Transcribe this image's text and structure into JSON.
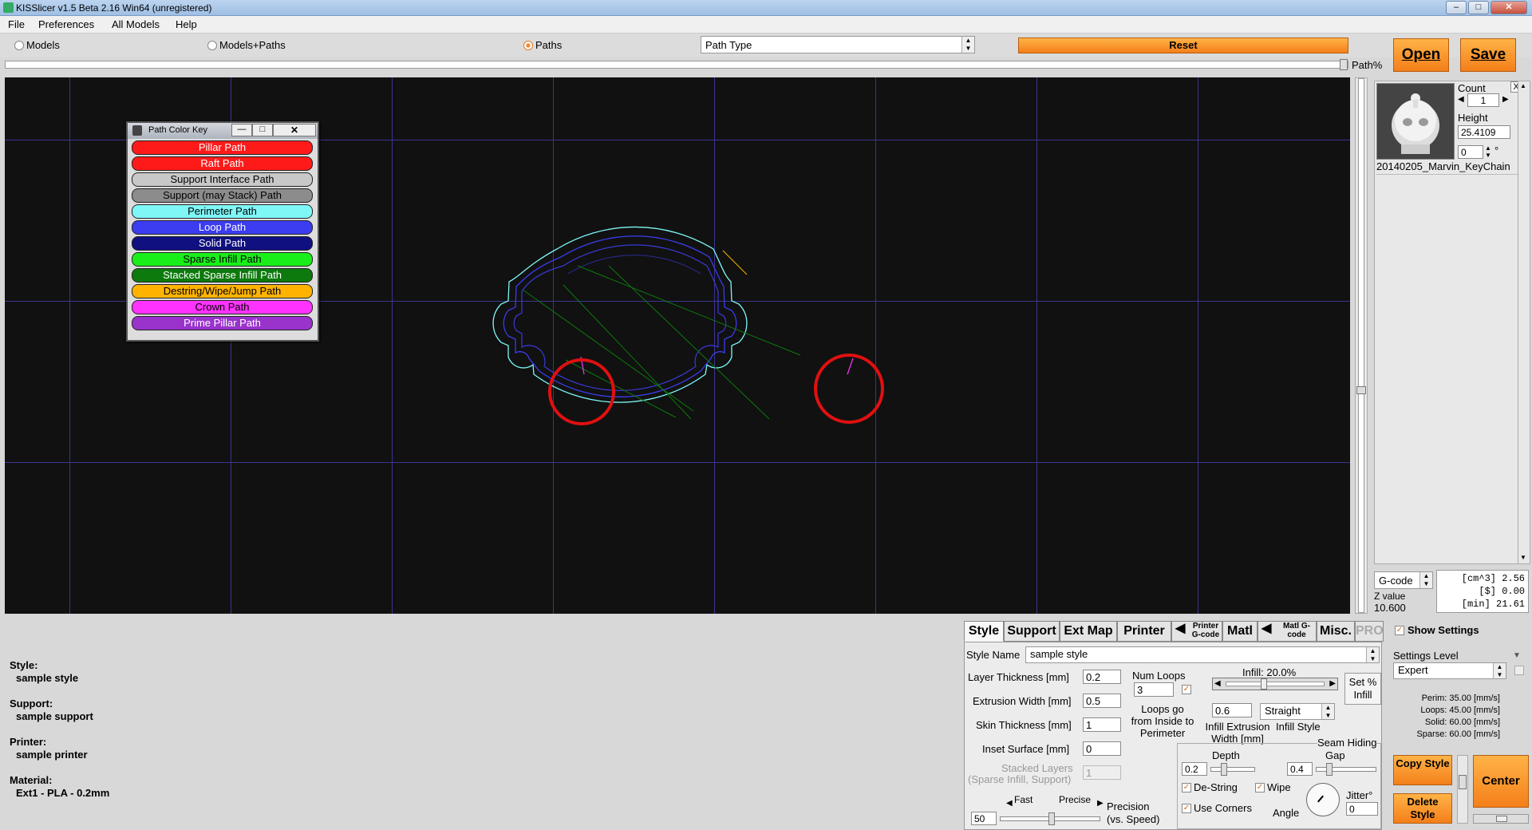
{
  "window": {
    "title": "KISSlicer v1.5 Beta 2.16 Win64 (unregistered)"
  },
  "menu": {
    "file": "File",
    "preferences": "Preferences",
    "all_models": "All Models",
    "help": "Help"
  },
  "view_modes": {
    "models": "Models",
    "models_paths": "Models+Paths",
    "paths": "Paths",
    "selected": "Paths"
  },
  "path_type_select": "Path Type",
  "buttons": {
    "reset": "Reset",
    "open": "Open",
    "save": "Save",
    "center": "Center",
    "copy_style": "Copy Style",
    "delete_style": "Delete Style",
    "set_infill": "Set % Infill"
  },
  "path_slider_label": "Path%",
  "path_color_key": {
    "title": "Path Color Key",
    "items": [
      {
        "label": "Pillar Path",
        "color": "#ff1a1a",
        "text": "#ffffff"
      },
      {
        "label": "Raft Path",
        "color": "#ff1a1a",
        "text": "#ffffff"
      },
      {
        "label": "Support Interface Path",
        "color": "#c8c8c8",
        "text": "#000000"
      },
      {
        "label": "Support (may Stack) Path",
        "color": "#8c8c8c",
        "text": "#000000"
      },
      {
        "label": "Perimeter Path",
        "color": "#7ff7f7",
        "text": "#000000"
      },
      {
        "label": "Loop Path",
        "color": "#3c3cf0",
        "text": "#ffffff"
      },
      {
        "label": "Solid Path",
        "color": "#101080",
        "text": "#ffffff"
      },
      {
        "label": "Sparse Infill Path",
        "color": "#1aee1a",
        "text": "#000000"
      },
      {
        "label": "Stacked Sparse Infill Path",
        "color": "#0c7a0c",
        "text": "#ffffff"
      },
      {
        "label": "Destring/Wipe/Jump Path",
        "color": "#ffb300",
        "text": "#000000"
      },
      {
        "label": "Crown Path",
        "color": "#ff33ff",
        "text": "#000000"
      },
      {
        "label": "Prime Pillar Path",
        "color": "#9933cc",
        "text": "#ffffff"
      }
    ]
  },
  "model_panel": {
    "count_label": "Count",
    "count": "1",
    "height_label": "Height",
    "height": "25.4109",
    "rotation": "0",
    "rotation_unit": "°",
    "model_name": "20140205_Marvin_KeyChain",
    "close": "X"
  },
  "output_panel": {
    "format": "G-code",
    "z_label": "Z value",
    "z": "10.600",
    "stats": [
      "[cm^3] 2.56",
      "[$] 0.00",
      "[min] 21.61"
    ]
  },
  "summary": {
    "style_label": "Style:",
    "style": "sample style",
    "support_label": "Support:",
    "support": "sample support",
    "printer_label": "Printer:",
    "printer": "sample printer",
    "material_label": "Material:",
    "material": "Ext1 - PLA - 0.2mm"
  },
  "tabs": [
    "Style",
    "Support",
    "Ext Map",
    "Printer",
    "Printer G-code",
    "Matl",
    "Matl G-code",
    "Misc.",
    "PRO"
  ],
  "style_settings": {
    "style_name_label": "Style Name",
    "style_name": "sample style",
    "layer_thickness_label": "Layer Thickness [mm]",
    "layer_thickness": "0.2",
    "extrusion_width_label": "Extrusion Width [mm]",
    "extrusion_width": "0.5",
    "skin_thickness_label": "Skin Thickness [mm]",
    "skin_thickness": "1",
    "inset_surface_label": "Inset  Surface [mm]",
    "inset_surface": "0",
    "stacked_layers_label": "Stacked Layers",
    "stacked_layers_sub": "(Sparse Infill, Support)",
    "stacked_layers": "1",
    "num_loops_label": "Num Loops",
    "num_loops": "3",
    "loops_inside_label": "Loops go from Inside to Perimeter",
    "infill_label": "Infill: 20.0%",
    "infill_percent": 20,
    "infill_ext_width": "0.6",
    "infill_ext_width_label": "Infill Extrusion Width [mm]",
    "infill_style": "Straight",
    "infill_style_label": "Infill Style",
    "seam_label": "Seam Hiding",
    "depth_label": "Depth",
    "depth": "0.2",
    "gap_label": "Gap",
    "gap": "0.4",
    "destring_label": "De-String",
    "wipe_label": "Wipe",
    "use_corners_label": "Use Corners",
    "angle_label": "Angle",
    "jitter_label": "Jitter°",
    "jitter": "0",
    "fast_label": "Fast",
    "precise_label": "Precise",
    "precision_value": "50",
    "precision_label": "Precision (vs. Speed)"
  },
  "right_settings": {
    "show_settings": "Show Settings",
    "settings_level_label": "Settings Level",
    "settings_level": "Expert",
    "speeds": [
      "Perim:  35.00 [mm/s]",
      "Loops:  45.00 [mm/s]",
      "Solid:  60.00 [mm/s]",
      "Sparse: 60.00 [mm/s]"
    ]
  }
}
